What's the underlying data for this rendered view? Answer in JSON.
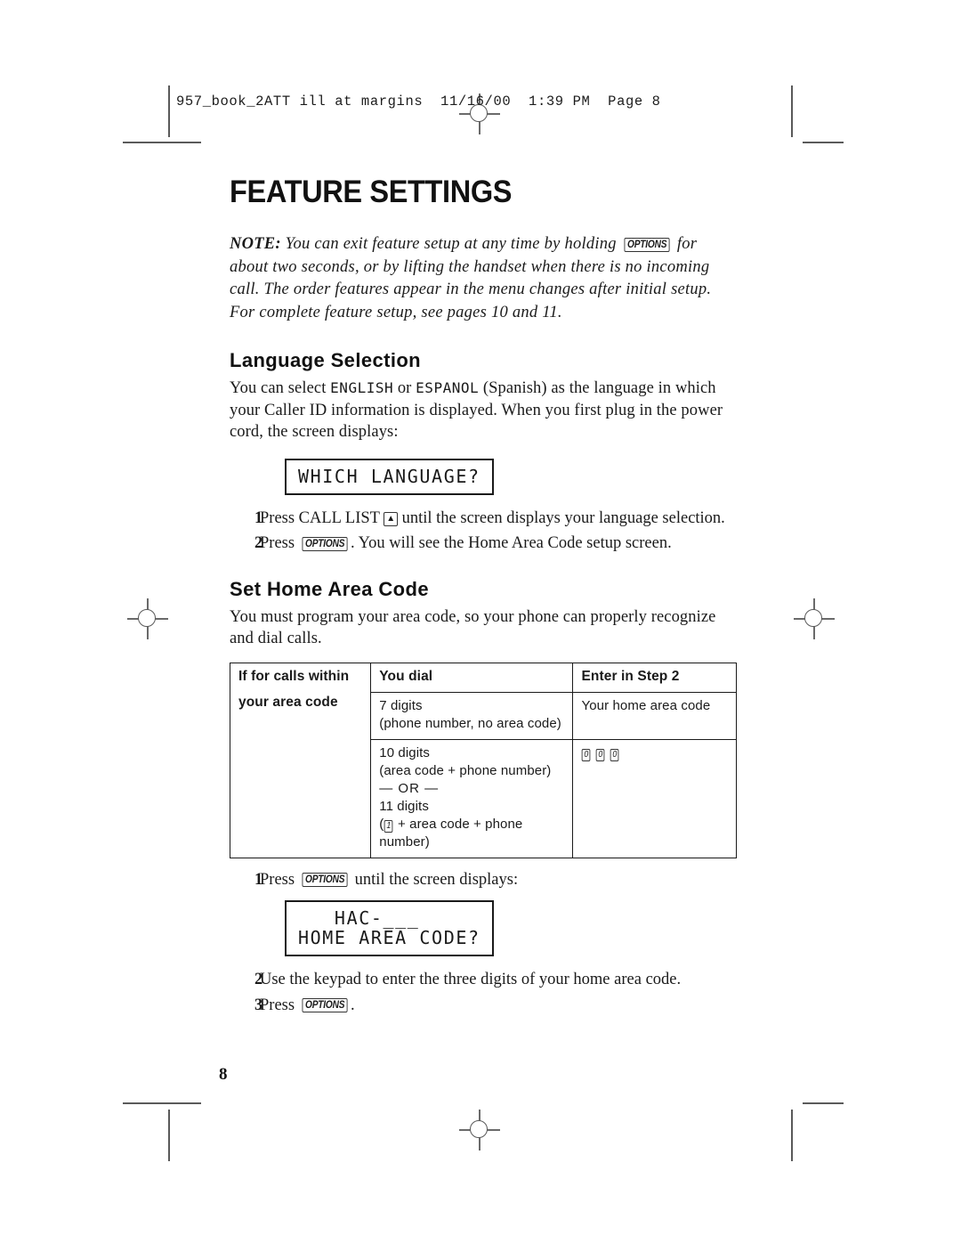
{
  "running_header": "957_book_2ATT ill at margins  11/16/00  1:39 PM  Page 8",
  "page_number": "8",
  "title": "FEATURE SETTINGS",
  "note": {
    "label": "NOTE:",
    "text_before_key": " You can exit feature setup at any time by holding ",
    "key": "OPTIONS",
    "text_after_key": " for about two seconds, or by lifting the handset when there is no incoming call. The order features appear in the menu changes after initial setup. For complete feature setup, see pages 10 and 11."
  },
  "language_section": {
    "heading": "Language Selection",
    "paragraph_part1": "You can select ",
    "lcd_word_1": "ENGLISH",
    "paragraph_part2": " or ",
    "lcd_word_2": "ESPANOL",
    "paragraph_part3": " (Spanish) as the language in which your Caller ID information is displayed. When you first plug in the power cord, the screen displays:",
    "lcd_display": "WHICH LANGUAGE?",
    "steps": [
      {
        "num": "1",
        "text_a": "Press CALL LIST ",
        "key": "▲",
        "text_b": " until the screen displays your language selection."
      },
      {
        "num": "2",
        "text_a": "Press ",
        "key": "OPTIONS",
        "text_b": ". You will see the Home Area Code setup screen."
      }
    ]
  },
  "home_area_code_section": {
    "heading": "Set Home Area Code",
    "paragraph": "You must program your area code, so your phone can properly recognize and dial calls.",
    "table": {
      "headers": [
        "If for calls within",
        "You dial",
        "Enter in Step 2"
      ],
      "col1_line2": "your area code",
      "rows": [
        {
          "you_dial": [
            "7 digits",
            "(phone number, no area code)"
          ],
          "enter_text": "Your home area code",
          "enter_keys": []
        },
        {
          "you_dial": [
            "10 digits",
            "(area code + phone number)",
            "— OR —",
            "11 digits"
          ],
          "you_dial_last_pre": "(",
          "you_dial_last_key": "1",
          "you_dial_last_post": " + area code + phone number)",
          "enter_text": "",
          "enter_keys": [
            "0",
            "0",
            "0"
          ]
        }
      ]
    },
    "steps": [
      {
        "num": "1",
        "text_a": "Press ",
        "key": "OPTIONS",
        "text_b": " until the screen displays:"
      },
      {
        "num": "2",
        "text_a": "Use the keypad to enter the three digits of your home area code.",
        "key": "",
        "text_b": ""
      },
      {
        "num": "3",
        "text_a": "Press ",
        "key": "OPTIONS",
        "text_b": "."
      }
    ],
    "lcd_display_line1": "   HAC-___",
    "lcd_display_line2": "HOME AREA CODE?"
  }
}
